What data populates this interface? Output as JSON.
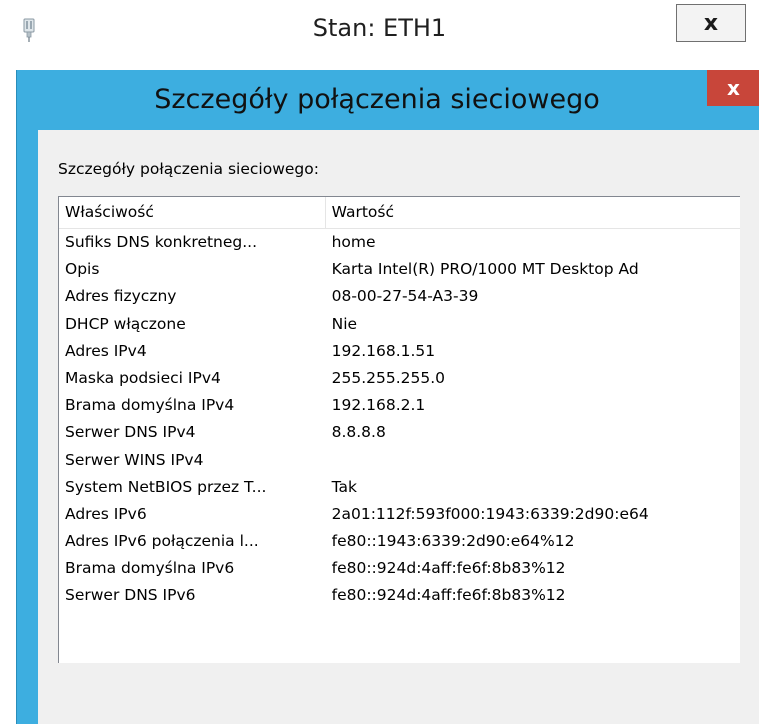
{
  "back_window": {
    "title": "Stan: ETH1",
    "close_label": "x"
  },
  "dialog": {
    "title": "Szczegóły połączenia sieciowego",
    "close_label": "x",
    "section_label": "Szczegóły połączenia sieciowego:",
    "columns": [
      "Właściwość",
      "Wartość"
    ],
    "rows": [
      {
        "property": "Sufiks DNS konkretneg...",
        "value": "home"
      },
      {
        "property": "Opis",
        "value": "Karta Intel(R) PRO/1000 MT Desktop Ad"
      },
      {
        "property": "Adres fizyczny",
        "value": "08-00-27-54-A3-39"
      },
      {
        "property": "DHCP włączone",
        "value": "Nie"
      },
      {
        "property": "Adres IPv4",
        "value": "192.168.1.51"
      },
      {
        "property": "Maska podsieci IPv4",
        "value": "255.255.255.0"
      },
      {
        "property": "Brama domyślna IPv4",
        "value": "192.168.2.1"
      },
      {
        "property": "Serwer DNS IPv4",
        "value": "8.8.8.8"
      },
      {
        "property": "Serwer WINS IPv4",
        "value": ""
      },
      {
        "property": "System NetBIOS przez T...",
        "value": "Tak"
      },
      {
        "property": "Adres IPv6",
        "value": "2a01:112f:593f000:1943:6339:2d90:e64"
      },
      {
        "property": "Adres IPv6 połączenia l...",
        "value": "fe80::1943:6339:2d90:e64%12"
      },
      {
        "property": "Brama domyślna IPv6",
        "value": "fe80::924d:4aff:fe6f:8b83%12"
      },
      {
        "property": "Serwer DNS IPv6",
        "value": "fe80::924d:4aff:fe6f:8b83%12"
      }
    ]
  },
  "icons": {
    "app_icon": "network-adapter-icon"
  },
  "colors": {
    "dialog_frame": "#3daee0",
    "dialog_close": "#c8463a",
    "dialog_body": "#f0f0f0"
  }
}
